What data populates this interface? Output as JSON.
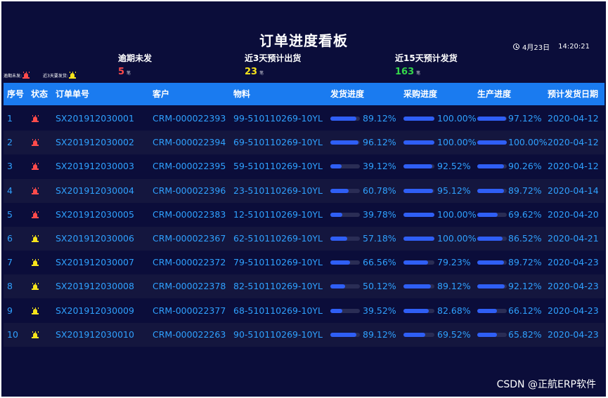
{
  "header": {
    "title": "订单进度看板",
    "date": "4月23日",
    "time": "14:20:21"
  },
  "stats": [
    {
      "label": "逾期未发",
      "value": "5",
      "unit": "笔",
      "color": "#ff4b4b"
    },
    {
      "label": "近3天预计出货",
      "value": "23",
      "unit": "笔",
      "color": "#f6e31b"
    },
    {
      "label": "近15天预计发货",
      "value": "163",
      "unit": "笔",
      "color": "#34d64a"
    }
  ],
  "legend": {
    "overdue": "逾期未发:",
    "due3": "近3天要发货:"
  },
  "columns": [
    "序号",
    "状态",
    "订单单号",
    "客户",
    "物料",
    "发货进度",
    "采购进度",
    "生产进度",
    "预计发货日期"
  ],
  "rows": [
    {
      "no": "1",
      "status": "overdue",
      "order": "SX201912030001",
      "customer": "CRM-000022393",
      "material": "99-510110269-10YL",
      "ship": "89.12%",
      "purchase": "100.00%",
      "production": "97.12%",
      "date": "2020-04-12",
      "ship_v": 0.8912,
      "purchase_v": 1.0,
      "production_v": 0.9712
    },
    {
      "no": "2",
      "status": "overdue",
      "order": "SX201912030002",
      "customer": "CRM-000022394",
      "material": "69-510110269-10YL",
      "ship": "96.12%",
      "purchase": "100.00%",
      "production": "100.00%",
      "date": "2020-04-12",
      "ship_v": 0.9612,
      "purchase_v": 1.0,
      "production_v": 1.0
    },
    {
      "no": "3",
      "status": "overdue",
      "order": "SX201912030003",
      "customer": "CRM-000022395",
      "material": "59-510110269-10YL",
      "ship": "39.12%",
      "purchase": "92.52%",
      "production": "90.26%",
      "date": "2020-04-12",
      "ship_v": 0.3912,
      "purchase_v": 0.9252,
      "production_v": 0.9026
    },
    {
      "no": "4",
      "status": "overdue",
      "order": "SX201912030004",
      "customer": "CRM-000022396",
      "material": "23-510110269-10YL",
      "ship": "60.78%",
      "purchase": "95.12%",
      "production": "89.72%",
      "date": "2020-04-14",
      "ship_v": 0.6078,
      "purchase_v": 0.9512,
      "production_v": 0.8972
    },
    {
      "no": "5",
      "status": "overdue",
      "order": "SX201912030005",
      "customer": "CRM-000022383",
      "material": "12-510110269-10YL",
      "ship": "39.78%",
      "purchase": "100.00%",
      "production": "69.62%",
      "date": "2020-04-20",
      "ship_v": 0.3978,
      "purchase_v": 1.0,
      "production_v": 0.6962
    },
    {
      "no": "6",
      "status": "due",
      "order": "SX201912030006",
      "customer": "CRM-000022367",
      "material": "62-510110269-10YL",
      "ship": "57.18%",
      "purchase": "100.00%",
      "production": "86.52%",
      "date": "2020-04-21",
      "ship_v": 0.5718,
      "purchase_v": 1.0,
      "production_v": 0.8652
    },
    {
      "no": "7",
      "status": "due",
      "order": "SX201912030007",
      "customer": "CRM-000022372",
      "material": "79-510110269-10YL",
      "ship": "66.56%",
      "purchase": "79.23%",
      "production": "89.72%",
      "date": "2020-04-23",
      "ship_v": 0.6656,
      "purchase_v": 0.7923,
      "production_v": 0.8972
    },
    {
      "no": "8",
      "status": "due",
      "order": "SX201912030008",
      "customer": "CRM-000022378",
      "material": "82-510110269-10YL",
      "ship": "50.12%",
      "purchase": "89.12%",
      "production": "92.12%",
      "date": "2020-04-23",
      "ship_v": 0.5012,
      "purchase_v": 0.8912,
      "production_v": 0.9212
    },
    {
      "no": "9",
      "status": "due",
      "order": "SX201912030009",
      "customer": "CRM-000022377",
      "material": "68-510110269-10YL",
      "ship": "39.52%",
      "purchase": "82.68%",
      "production": "66.12%",
      "date": "2020-04-23",
      "ship_v": 0.3952,
      "purchase_v": 0.8268,
      "production_v": 0.6612
    },
    {
      "no": "10",
      "status": "due",
      "order": "SX201912030010",
      "customer": "CRM-000022263",
      "material": "90-510110269-10YL",
      "ship": "89.12%",
      "purchase": "69.52%",
      "production": "65.82%",
      "date": "2020-04-23",
      "ship_v": 0.8912,
      "purchase_v": 0.6952,
      "production_v": 0.6582
    }
  ],
  "watermark": "CSDN @正航ERP软件",
  "colors": {
    "background": "#0b0d3a",
    "header": "#1a7bf0",
    "text": "#2fa1ff",
    "bar": "#2f5ff5"
  }
}
